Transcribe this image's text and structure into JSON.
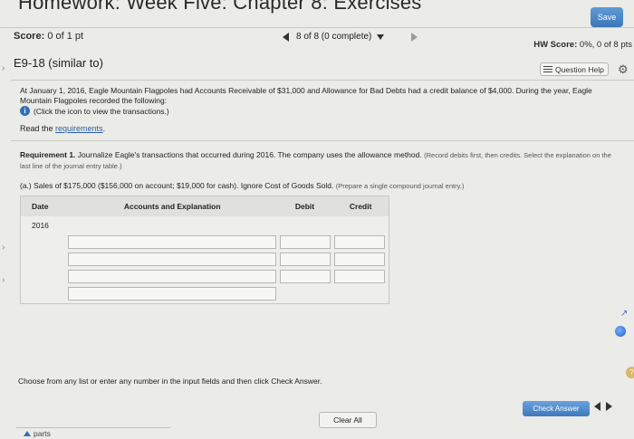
{
  "header": {
    "title": "Homework: Week Five: Chapter 8: Exercises",
    "save_label": "Save"
  },
  "score": {
    "label": "Score:",
    "value": "0 of 1 pt"
  },
  "navigation": {
    "progress": "8 of 8 (0 complete)"
  },
  "hw_score": {
    "label": "HW Score:",
    "value": "0%, 0 of 8 pts"
  },
  "problem": {
    "id": "E9-18 (similar to)",
    "question_help_label": "Question Help"
  },
  "intro": {
    "text": "At January 1, 2016, Eagle Mountain Flagpoles had Accounts Receivable of $31,000 and Allowance for Bad Debts had a credit balance of $4,000. During the year, Eagle Mountain Flagpoles recorded the following:",
    "click_icon_text": "(Click the icon to view the transactions.)",
    "read_prefix": "Read the ",
    "requirements_link": "requirements"
  },
  "requirement1": {
    "label": "Requirement 1.",
    "text": "Journalize Eagle's transactions that occurred during 2016. The company uses the allowance method.",
    "note": "(Record debits first, then credits. Select the explanation on the last line of the journal entry table.)"
  },
  "part_a": {
    "text": "(a.) Sales of $175,000 ($156,000 on account; $19,000 for cash). Ignore Cost of Goods Sold.",
    "note": "(Prepare a single compound journal entry.)"
  },
  "journal": {
    "headers": {
      "date": "Date",
      "accounts": "Accounts and Explanation",
      "debit": "Debit",
      "credit": "Credit"
    },
    "year": "2016",
    "rows": 5
  },
  "footer": {
    "instruction": "Choose from any list or enter any number in the input fields and then click Check Answer.",
    "check_answer_label": "Check Answer",
    "clear_all_label": "Clear All",
    "parts_label": "parts"
  },
  "colors": {
    "accent": "#3c76b8",
    "link": "#2b5fa5",
    "info_icon": "#2f6fb7"
  }
}
